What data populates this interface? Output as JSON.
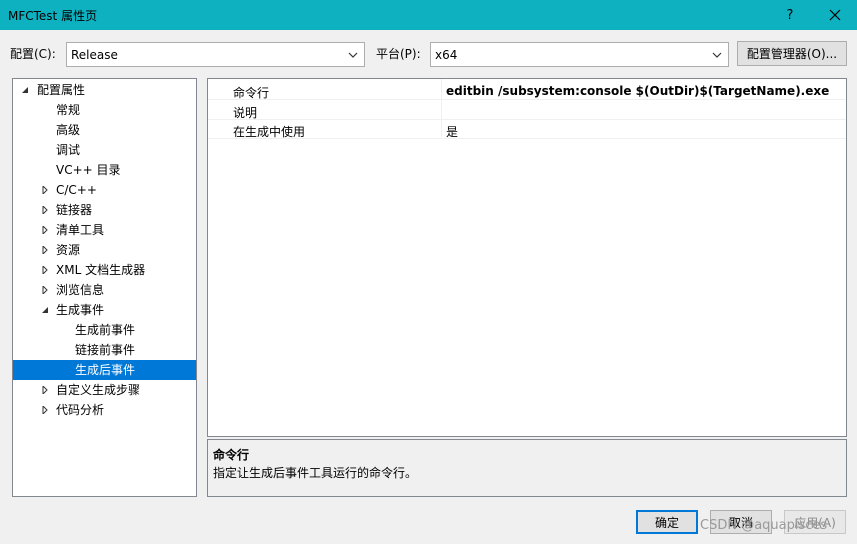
{
  "window": {
    "title": "MFCTest 属性页",
    "help_label": "?",
    "colors": {
      "titlebar": "#0db1c0",
      "selection": "#0078d7"
    }
  },
  "toolbar": {
    "config_label": "配置(C):",
    "config_value": "Release",
    "platform_label": "平台(P):",
    "platform_value": "x64",
    "config_manager_label": "配置管理器(O)..."
  },
  "tree": {
    "items": [
      {
        "label": "配置属性",
        "expander": "expanded"
      },
      {
        "label": "常规",
        "expander": "none"
      },
      {
        "label": "高级",
        "expander": "none"
      },
      {
        "label": "调试",
        "expander": "none"
      },
      {
        "label": "VC++ 目录",
        "expander": "none"
      },
      {
        "label": "C/C++",
        "expander": "collapsed"
      },
      {
        "label": "链接器",
        "expander": "collapsed"
      },
      {
        "label": "清单工具",
        "expander": "collapsed"
      },
      {
        "label": "资源",
        "expander": "collapsed"
      },
      {
        "label": "XML 文档生成器",
        "expander": "collapsed"
      },
      {
        "label": "浏览信息",
        "expander": "collapsed"
      },
      {
        "label": "生成事件",
        "expander": "expanded"
      },
      {
        "label": "生成前事件",
        "expander": "none"
      },
      {
        "label": "链接前事件",
        "expander": "none"
      },
      {
        "label": "生成后事件",
        "expander": "none",
        "selected": true
      },
      {
        "label": "自定义生成步骤",
        "expander": "collapsed"
      },
      {
        "label": "代码分析",
        "expander": "collapsed"
      }
    ]
  },
  "grid": {
    "rows": [
      {
        "name": "命令行",
        "value": "editbin /subsystem:console $(OutDir)$(TargetName).exe"
      },
      {
        "name": "说明",
        "value": ""
      },
      {
        "name": "在生成中使用",
        "value": "是"
      }
    ]
  },
  "description": {
    "title": "命令行",
    "text": "指定让生成后事件工具运行的命令行。"
  },
  "buttons": {
    "ok": "确定",
    "cancel": "取消",
    "apply": "应用(A)"
  },
  "watermark": "CSDN @aquapisces"
}
